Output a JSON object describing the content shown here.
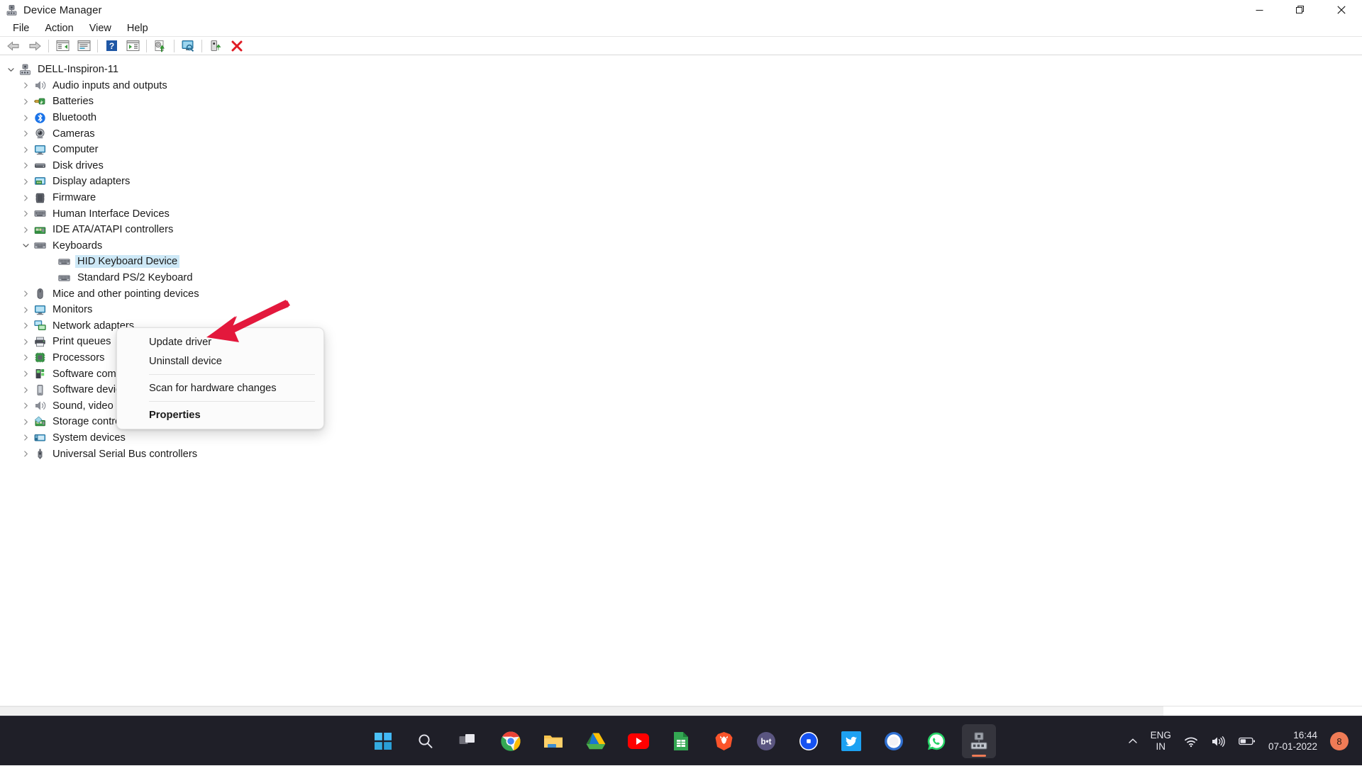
{
  "window": {
    "title": "Device Manager",
    "app_icon": "device-manager-icon",
    "controls": {
      "minimize": "—",
      "restore": "❐",
      "close": "✕"
    }
  },
  "menubar": {
    "items": [
      {
        "label": "File",
        "name": "menu-file"
      },
      {
        "label": "Action",
        "name": "menu-action"
      },
      {
        "label": "View",
        "name": "menu-view"
      },
      {
        "label": "Help",
        "name": "menu-help"
      }
    ]
  },
  "toolbar": {
    "buttons": [
      {
        "name": "back-button",
        "icon": "back-arrow-icon"
      },
      {
        "name": "forward-button",
        "icon": "forward-arrow-icon"
      },
      {
        "name": "show-hide-console-tree-button",
        "icon": "console-tree-icon"
      },
      {
        "name": "properties-button",
        "icon": "properties-icon"
      },
      {
        "name": "help-button",
        "icon": "help-question-icon"
      },
      {
        "name": "show-hide-action-pane-button",
        "icon": "action-pane-icon"
      },
      {
        "name": "update-driver-button",
        "icon": "update-driver-icon"
      },
      {
        "name": "scan-hardware-changes-button",
        "icon": "scan-monitor-icon"
      },
      {
        "name": "enable-device-button",
        "icon": "enable-device-icon"
      },
      {
        "name": "uninstall-device-button",
        "icon": "uninstall-red-x-icon"
      }
    ]
  },
  "tree": {
    "root": {
      "label": "DELL-Inspiron-11",
      "icon": "computer-root-icon",
      "expanded": true
    },
    "nodes": [
      {
        "label": "Audio inputs and outputs",
        "icon": "speaker-icon",
        "level": 1,
        "expanded": false
      },
      {
        "label": "Batteries",
        "icon": "battery-icon",
        "level": 1,
        "expanded": false
      },
      {
        "label": "Bluetooth",
        "icon": "bluetooth-icon",
        "level": 1,
        "expanded": false
      },
      {
        "label": "Cameras",
        "icon": "camera-icon",
        "level": 1,
        "expanded": false
      },
      {
        "label": "Computer",
        "icon": "monitor-icon",
        "level": 1,
        "expanded": false
      },
      {
        "label": "Disk drives",
        "icon": "disk-drive-icon",
        "level": 1,
        "expanded": false
      },
      {
        "label": "Display adapters",
        "icon": "display-adapter-icon",
        "level": 1,
        "expanded": false
      },
      {
        "label": "Firmware",
        "icon": "firmware-chip-icon",
        "level": 1,
        "expanded": false
      },
      {
        "label": "Human Interface Devices",
        "icon": "hid-icon",
        "level": 1,
        "expanded": false
      },
      {
        "label": "IDE ATA/ATAPI controllers",
        "icon": "ide-controller-icon",
        "level": 1,
        "expanded": false
      },
      {
        "label": "Keyboards",
        "icon": "keyboard-icon",
        "level": 1,
        "expanded": true
      },
      {
        "label": "HID Keyboard Device",
        "icon": "keyboard-icon",
        "level": 2,
        "selected": true
      },
      {
        "label": "Standard PS/2 Keyboard",
        "icon": "keyboard-icon",
        "level": 2
      },
      {
        "label": "Mice and other pointing devices",
        "icon": "mouse-icon",
        "level": 1,
        "expanded": false
      },
      {
        "label": "Monitors",
        "icon": "monitor-icon",
        "level": 1,
        "expanded": false
      },
      {
        "label": "Network adapters",
        "icon": "network-adapter-icon",
        "level": 1,
        "expanded": false
      },
      {
        "label": "Print queues",
        "icon": "printer-icon",
        "level": 1,
        "expanded": false
      },
      {
        "label": "Processors",
        "icon": "processor-icon",
        "level": 1,
        "expanded": false
      },
      {
        "label": "Software components",
        "icon": "software-component-icon",
        "level": 1,
        "expanded": false
      },
      {
        "label": "Software devices",
        "icon": "software-device-icon",
        "level": 1,
        "expanded": false
      },
      {
        "label": "Sound, video and game controllers",
        "icon": "speaker-icon",
        "level": 1,
        "expanded": false
      },
      {
        "label": "Storage controllers",
        "icon": "storage-controller-icon",
        "level": 1,
        "expanded": false
      },
      {
        "label": "System devices",
        "icon": "system-device-icon",
        "level": 1,
        "expanded": false
      },
      {
        "label": "Universal Serial Bus controllers",
        "icon": "usb-icon",
        "level": 1,
        "expanded": false
      }
    ]
  },
  "context_menu": {
    "items": [
      {
        "label": "Update driver",
        "name": "ctx-update-driver",
        "bold": false
      },
      {
        "label": "Uninstall device",
        "name": "ctx-uninstall-device",
        "bold": false
      },
      {
        "separator": true
      },
      {
        "label": "Scan for hardware changes",
        "name": "ctx-scan-hardware-changes",
        "bold": false
      },
      {
        "separator": true
      },
      {
        "label": "Properties",
        "name": "ctx-properties",
        "bold": true
      }
    ]
  },
  "annotation": {
    "type": "arrow",
    "color": "#e3183c",
    "points_to": "Update driver"
  },
  "taskbar": {
    "apps": [
      {
        "name": "start-button",
        "icon": "windows-logo-icon"
      },
      {
        "name": "search-button",
        "icon": "search-icon"
      },
      {
        "name": "task-view-button",
        "icon": "task-view-icon"
      },
      {
        "name": "chrome-button",
        "icon": "chrome-icon"
      },
      {
        "name": "file-explorer-button",
        "icon": "folder-icon"
      },
      {
        "name": "google-drive-button",
        "icon": "google-drive-icon"
      },
      {
        "name": "youtube-button",
        "icon": "youtube-icon"
      },
      {
        "name": "google-sheets-button",
        "icon": "sheets-icon"
      },
      {
        "name": "brave-button",
        "icon": "brave-lion-icon"
      },
      {
        "name": "bitly-button",
        "icon": "bitly-icon",
        "label": "b∙t"
      },
      {
        "name": "coinbase-button",
        "icon": "coinbase-icon"
      },
      {
        "name": "twitter-button",
        "icon": "twitter-bird-icon"
      },
      {
        "name": "signal-button",
        "icon": "signal-icon"
      },
      {
        "name": "whatsapp-button",
        "icon": "whatsapp-icon"
      },
      {
        "name": "device-manager-taskbar-button",
        "icon": "device-manager-icon",
        "active": true
      }
    ],
    "tray": {
      "chevron": "show-hidden-icons-icon",
      "language": {
        "line1": "ENG",
        "line2": "IN"
      },
      "wifi": "wifi-icon",
      "volume": "volume-icon",
      "battery": "battery-icon",
      "time": "16:44",
      "date": "07-01-2022",
      "notification_count": "8"
    }
  }
}
